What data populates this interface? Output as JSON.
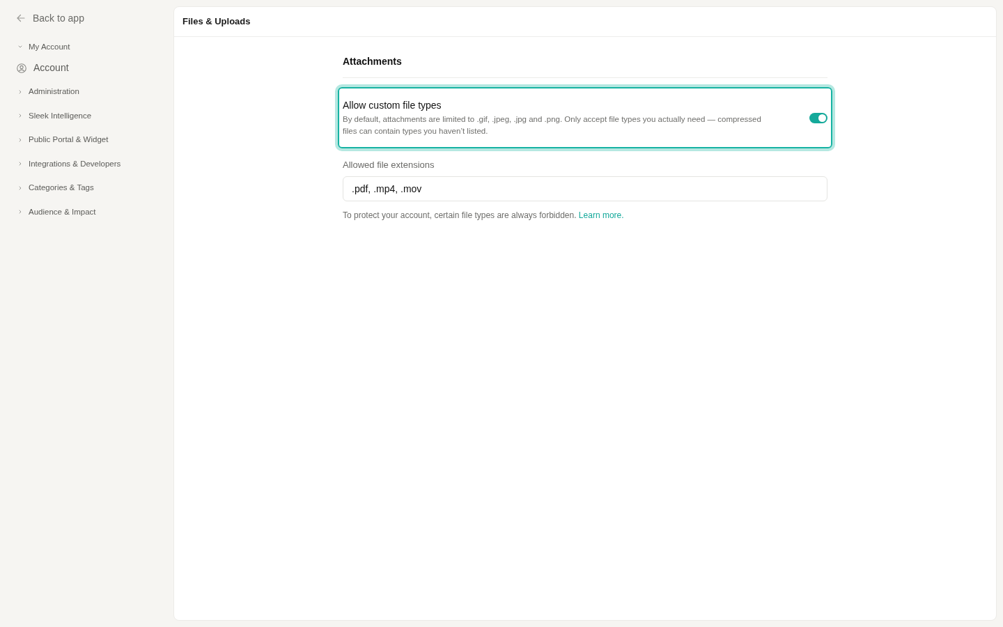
{
  "sidebar": {
    "back_link": "Back to app",
    "groups": [
      {
        "label": "My Account",
        "expanded": true,
        "children": [
          {
            "label": "Account"
          }
        ]
      },
      {
        "label": "Administration",
        "expanded": false
      },
      {
        "label": "Sleek Intelligence",
        "expanded": false
      },
      {
        "label": "Public Portal & Widget",
        "expanded": false
      },
      {
        "label": "Integrations & Developers",
        "expanded": false
      },
      {
        "label": "Categories & Tags",
        "expanded": false
      },
      {
        "label": "Audience & Impact",
        "expanded": false
      }
    ]
  },
  "page": {
    "title": "Files & Uploads",
    "section": {
      "title": "Attachments",
      "setting": {
        "title": "Allow custom file types",
        "description": "By default, attachments are limited to .gif, .jpeg, .jpg and .png. Only accept file types you actually need — compressed files can contain types you haven’t listed.",
        "on": true,
        "highlighted": true
      },
      "field": {
        "label": "Allowed file extensions",
        "value": ".pdf, .mp4, .mov"
      },
      "help": {
        "text": "To protect your account, certain file types are always forbidden.",
        "link": "Learn more."
      }
    }
  }
}
